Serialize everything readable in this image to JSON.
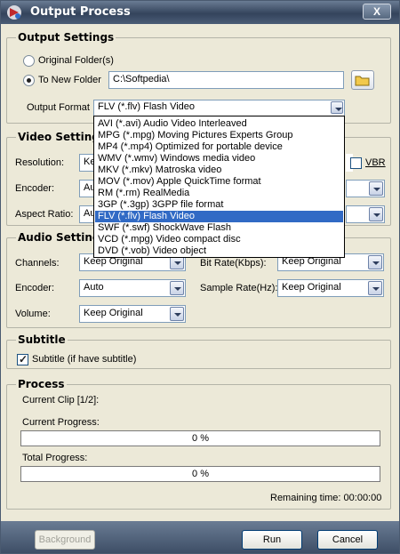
{
  "window": {
    "title": "Output Process",
    "close_label": "X"
  },
  "output_settings": {
    "title": "Output Settings",
    "original_folder_label": "Original Folder(s)",
    "new_folder_label": "To New Folder",
    "new_folder_path": "C:\\Softpedia\\",
    "output_format_label": "Output Format :",
    "output_format_value": "FLV  (*.flv) Flash Video"
  },
  "video_settings": {
    "title": "Video Settings",
    "resolution_label": "Resolution:",
    "resolution_value": "Ke",
    "encoder_label": "Encoder:",
    "encoder_value": "Au",
    "aspect_label": "Aspect Ratio:",
    "aspect_value": "Au",
    "vbr_label": "VBR"
  },
  "format_options": [
    "AVI  (*.avi) Audio Video Interleaved",
    "MPG  (*.mpg) Moving Pictures Experts Group",
    "MP4  (*.mp4) Optimized for portable device",
    "WMV  (*.wmv) Windows media video",
    "MKV  (*.mkv) Matroska video",
    "MOV  (*.mov) Apple QuickTime format",
    "RM   (*.rm) RealMedia",
    "3GP  (*.3gp) 3GPP file format",
    "FLV  (*.flv) Flash Video",
    "SWF  (*.swf) ShockWave Flash",
    "VCD  (*.mpg) Video compact disc",
    "DVD  (*.vob) Video object"
  ],
  "audio_settings": {
    "title": "Audio Settings",
    "channels_label": "Channels:",
    "channels_value": "Keep Original",
    "bitrate_label": "Bit Rate(Kbps):",
    "bitrate_value": "Keep Original",
    "encoder_label": "Encoder:",
    "encoder_value": "Auto",
    "sample_rate_label": "Sample Rate(Hz):",
    "sample_rate_value": "Keep Original",
    "volume_label": "Volume:",
    "volume_value": "Keep Original"
  },
  "subtitle": {
    "title": "Subtitle",
    "checkbox_label": "Subtitle (if have subtitle)"
  },
  "process": {
    "title": "Process",
    "current_clip": "Current Clip [1/2]:",
    "current_progress_label": "Current Progress:",
    "current_progress_value": "0 %",
    "current_progress_fraction": 0,
    "total_progress_label": "Total Progress:",
    "total_progress_value": "0 %",
    "total_progress_fraction": 0,
    "remaining": "Remaining time: 00:00:00"
  },
  "buttons": {
    "background": "Background",
    "run": "Run",
    "cancel": "Cancel"
  },
  "colors": {
    "selection": "#316ac5",
    "titlebar": "#3e4e66",
    "window_bg": "#ece9d8"
  }
}
